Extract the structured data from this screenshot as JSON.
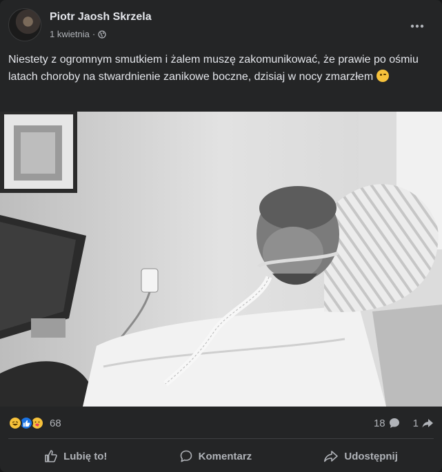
{
  "post": {
    "author": "Piotr Jaosh Skrzela",
    "date": "1 kwietnia",
    "separator": "·",
    "privacy_icon": "globe-icon",
    "more_icon": "more-options-icon",
    "text": "Niestety z ogromnym smutkiem i żalem muszę zakomunikować, że prawie po ośmiu latach choroby na stwardnienie zanikowe boczne, dzisiaj w nocy zmarzłem",
    "text_emoji": "winking-smile-emoji"
  },
  "stats": {
    "reaction_icons": [
      "haha-reaction-icon",
      "like-reaction-icon",
      "care-reaction-icon"
    ],
    "reaction_count": "68",
    "comment_count": "18",
    "share_count": "1"
  },
  "actions": {
    "like_label": "Lubię to!",
    "comment_label": "Komentarz",
    "share_label": "Udostępnij"
  },
  "colors": {
    "card_bg": "#242526",
    "text_primary": "#e4e6eb",
    "text_secondary": "#b0b3b8",
    "like_blue": "#1b74e4"
  }
}
